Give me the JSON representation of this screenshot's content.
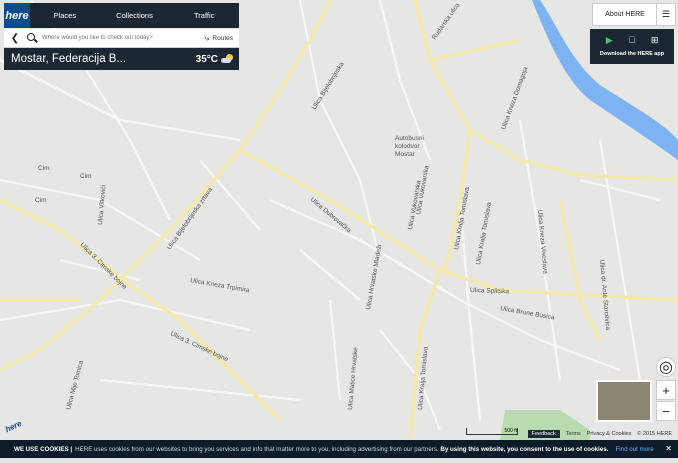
{
  "nav": {
    "logo": "here",
    "tabs": [
      "Places",
      "Collections",
      "Traffic"
    ]
  },
  "search": {
    "placeholder": "Where would you like to check out today?",
    "routes_label": "Routes"
  },
  "weather": {
    "city": "Mostar, Federacija B...",
    "temp": "35°C"
  },
  "header_right": {
    "about": "About HERE",
    "app_download": "Download the HERE app"
  },
  "map_labels": {
    "streets": [
      "Ulica Bijelobrijeska",
      "Ulica Dubrovačka",
      "Ulica Splitska",
      "Ulica Kralja Tomislava",
      "Ulica Bijelobrijeska zrtava",
      "Ulica Kneza Trpimira",
      "Ulica 3. Cimske bojne",
      "Ulica Mije Tomica",
      "Ulica Brune Busica",
      "Ulica Kneza Viseslava",
      "Ulica dr. Ante Starcevica",
      "Ulica Hrvatske Mladeži",
      "Ulica Matice Hrvatske",
      "Ulica Vukovarska",
      "Ulica Vitkovići",
      "Rudarska ulica",
      "Ulica Kralja Tomislava",
      "Ulica Kralja Tomislava",
      "Ulica Kneza Domagoja",
      "Ulica Vukovarska"
    ],
    "poi": [
      "Autobusni kolodvor Mostar"
    ],
    "short": [
      "Cim",
      "Cim",
      "Cim"
    ]
  },
  "controls": {
    "zoom_in": "+",
    "zoom_out": "−",
    "locate": "◎"
  },
  "footer": {
    "scale": "500 ft",
    "feedback": "Feedback",
    "terms": "Terms",
    "privacy": "Privacy & Cookies",
    "copyright": "© 2015 HERE"
  },
  "cookie": {
    "title": "WE USE COOKIES |",
    "text": "HERE uses cookies from our websites to bring you services and info that matter more to you, including advertising from our partners.",
    "consent": "By using this website, you consent to the use of cookies.",
    "more": "Find out more",
    "close": "✕"
  }
}
